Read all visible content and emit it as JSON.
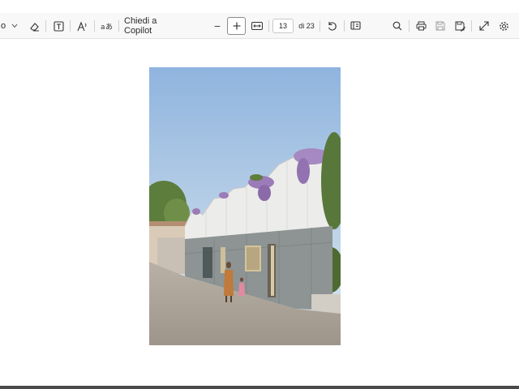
{
  "toolbar": {
    "left_partial": "o",
    "ask_copilot": "Chiedi a Copilot",
    "zoom_out": "−",
    "page_number": "13",
    "page_total": "di 23"
  },
  "icons": {
    "dropdown": "chevron-down-icon",
    "eraser": "eraser-icon",
    "text_box": "text-box-icon",
    "read_aloud": "read-aloud-icon",
    "translate": "translate-icon",
    "zoom_out": "minus-icon",
    "zoom_in": "plus-icon",
    "fit_page": "fit-page-icon",
    "rotate": "rotate-icon",
    "page_view": "page-view-icon",
    "search": "search-icon",
    "print": "print-icon",
    "save": "save-icon",
    "save_as": "save-as-icon",
    "fullscreen": "expand-icon",
    "settings": "gear-icon"
  },
  "colors": {
    "toolbar_bg": "#f8f8f8",
    "page_bg": "#ffffff",
    "sky": "#a9c6e6",
    "ground": "#a89f93",
    "stone": "#8d9493",
    "wisteria": "#9b7bb8"
  }
}
